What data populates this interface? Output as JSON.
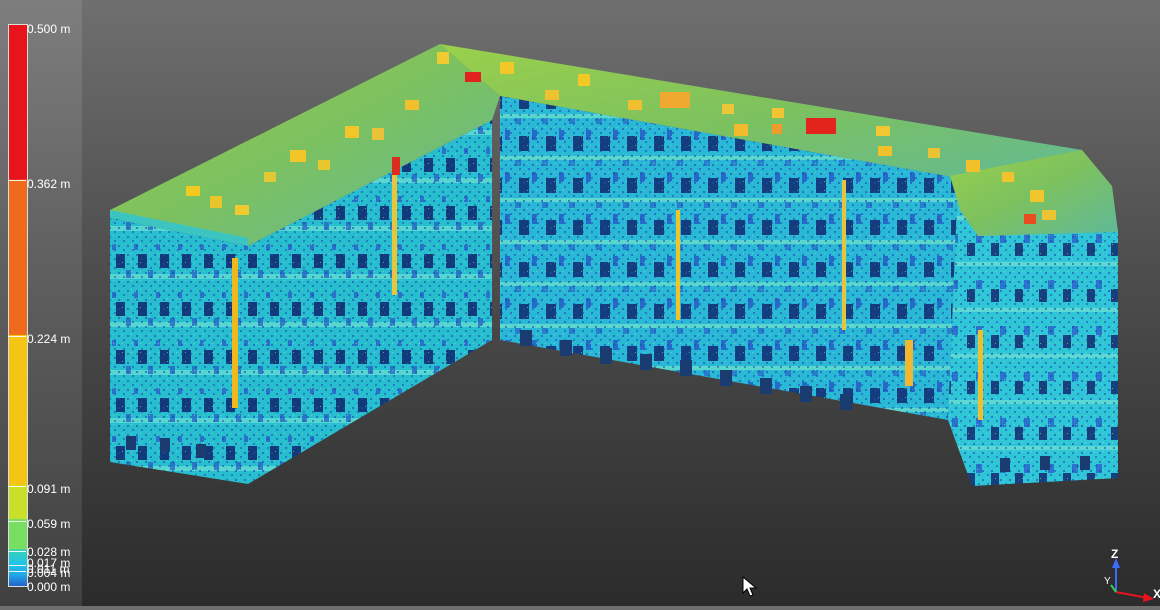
{
  "color_scale": {
    "unit": "m",
    "labels": [
      "0.500 m",
      "0.362 m",
      "0.224 m",
      "0.091 m",
      "0.059 m",
      "0.028 m",
      "0.017 m",
      "0.011 m",
      "0.004 m",
      "0.000 m"
    ],
    "colors": {
      "red": "#e8141b",
      "orange": "#ef6a1c",
      "yellow": "#f5c513",
      "lime": "#c9df2a",
      "green": "#78de62",
      "aqua": "#3ad2b4",
      "cyan": "#22c4e8",
      "blue": "#2563c9"
    }
  },
  "view": {
    "axis_labels": {
      "z": "Z",
      "y": "Y",
      "x": "X"
    }
  },
  "icons": [
    "mouse-pointer-icon",
    "axis-gizmo-icon"
  ]
}
